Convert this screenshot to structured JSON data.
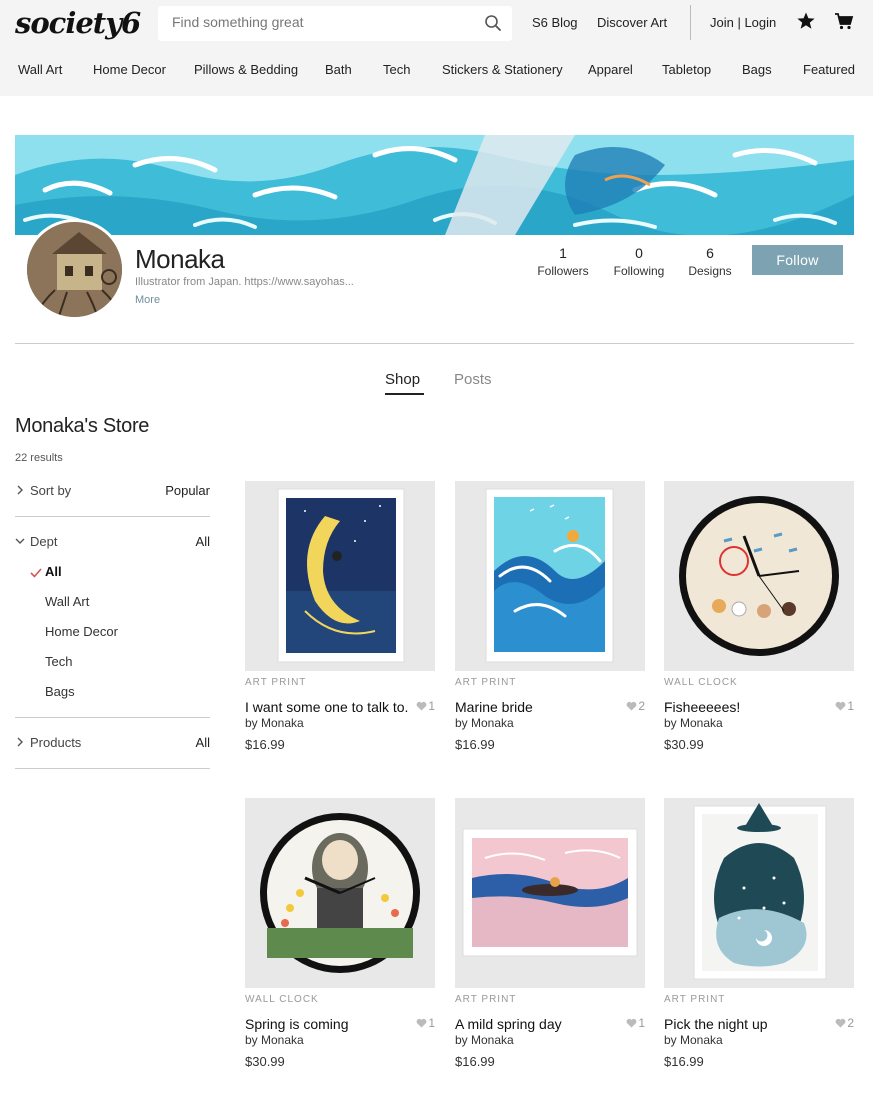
{
  "header": {
    "logo": "society6",
    "search_placeholder": "Find something great",
    "links": [
      "S6 Blog",
      "Discover Art",
      "Join | Login"
    ]
  },
  "nav": [
    "Wall Art",
    "Home Decor",
    "Pillows & Bedding",
    "Bath",
    "Tech",
    "Stickers & Stationery",
    "Apparel",
    "Tabletop",
    "Bags",
    "Featured"
  ],
  "profile": {
    "name": "Monaka",
    "bio": "Illustrator from Japan. https://www.sayohas...",
    "more": "More",
    "stats": [
      {
        "num": "1",
        "label": "Followers"
      },
      {
        "num": "0",
        "label": "Following"
      },
      {
        "num": "6",
        "label": "Designs"
      }
    ],
    "follow_label": "Follow"
  },
  "tabs": [
    "Shop",
    "Posts"
  ],
  "sidebar": {
    "store_title": "Monaka's Store",
    "results": "22 results",
    "sort_label": "Sort by",
    "sort_value": "Popular",
    "dept_label": "Dept",
    "dept_value": "All",
    "dept_items": [
      "All",
      "Wall Art",
      "Home Decor",
      "Tech",
      "Bags"
    ],
    "products_label": "Products",
    "products_value": "All"
  },
  "products": [
    {
      "category": "ART PRINT",
      "title": "I want some one to talk to.",
      "by": "by Monaka",
      "price": "$16.99",
      "likes": "1"
    },
    {
      "category": "ART PRINT",
      "title": "Marine bride",
      "by": "by Monaka",
      "price": "$16.99",
      "likes": "2"
    },
    {
      "category": "WALL CLOCK",
      "title": "Fisheeeees!",
      "by": "by Monaka",
      "price": "$30.99",
      "likes": "1"
    },
    {
      "category": "WALL CLOCK",
      "title": "Spring is coming",
      "by": "by Monaka",
      "price": "$30.99",
      "likes": "1"
    },
    {
      "category": "ART PRINT",
      "title": "A mild spring day",
      "by": "by Monaka",
      "price": "$16.99",
      "likes": "1"
    },
    {
      "category": "ART PRINT",
      "title": "Pick the night up",
      "by": "by Monaka",
      "price": "$16.99",
      "likes": "2"
    }
  ],
  "icons": {
    "search": "search-icon",
    "star": "star-icon",
    "cart": "cart-icon",
    "heart": "heart-icon",
    "chevron": "chevron-icon",
    "check": "check-icon"
  },
  "colors": {
    "accent": "#7da3b3",
    "check": "#d9534f",
    "topbar": "#f4f4f4"
  }
}
